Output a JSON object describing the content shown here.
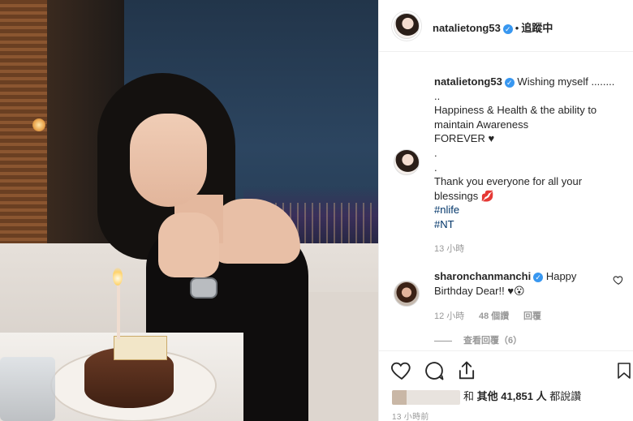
{
  "post": {
    "author": "natalietong53",
    "follow_label": "追蹤中",
    "separator": "•",
    "caption_lines": [
      "Wishing myself ........",
      "..",
      "Happiness & Health & the ability to",
      "maintain Awareness",
      "FOREVER ♥",
      ".",
      ".",
      "Thank you everyone for all your",
      "blessings 💋"
    ],
    "hashtags": [
      "#nlife",
      "#NT"
    ],
    "caption_time": "13 小時",
    "likes_prefix": "和",
    "likes_text": "其他 41,851 人",
    "likes_suffix": "都說讚",
    "post_time": "13 小時前"
  },
  "comment": {
    "author": "sharonchanmanchi",
    "text_first": "Happy",
    "text_second": "Birthday Dear!! ♥😮",
    "time": "12 小時",
    "likes": "48 個讚",
    "reply": "回覆",
    "view_replies": "查看回覆（6）"
  },
  "icons": {
    "verified": "verified-badge-icon",
    "like": "heart-icon",
    "comment": "comment-bubble-icon",
    "share": "share-icon",
    "save": "bookmark-icon"
  },
  "colors": {
    "verified": "#3897f0",
    "hashtag": "#003569",
    "muted": "#999999"
  }
}
